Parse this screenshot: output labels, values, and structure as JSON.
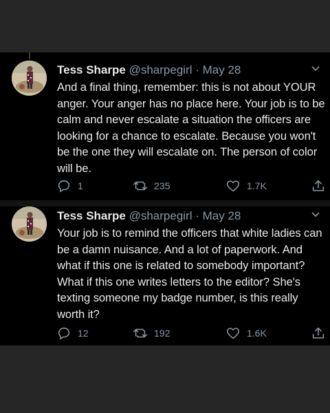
{
  "tweets": [
    {
      "author_name": "Tess Sharpe",
      "handle": "@sharpegirl",
      "separator": "·",
      "date": "May 28",
      "text": "And a final thing, remember: this is not about YOUR anger. Your anger has no place here. Your job is to be calm and never escalate a situation the officers are looking for a chance to escalate. Because you won't be the one they will escalate on. The person of color will be.",
      "replies": "1",
      "retweets": "235",
      "likes": "1.7K"
    },
    {
      "author_name": "Tess Sharpe",
      "handle": "@sharpegirl",
      "separator": "·",
      "date": "May 28",
      "text": "Your job is to remind the officers that white ladies can be a damn nuisance. And a lot of paperwork. And what if this one is related to somebody important? What if this one writes letters to the editor? She's texting someone my badge number, is this really worth it?",
      "replies": "12",
      "retweets": "192",
      "likes": "1.6K"
    }
  ],
  "icons": {
    "reply": "reply-icon",
    "retweet": "retweet-icon",
    "like": "heart-icon",
    "share": "share-icon",
    "menu": "chevron-down-icon"
  },
  "colors": {
    "background": "#000000",
    "outer": "#262626",
    "text": "#e7e9ea",
    "secondary": "#8b98a5"
  }
}
